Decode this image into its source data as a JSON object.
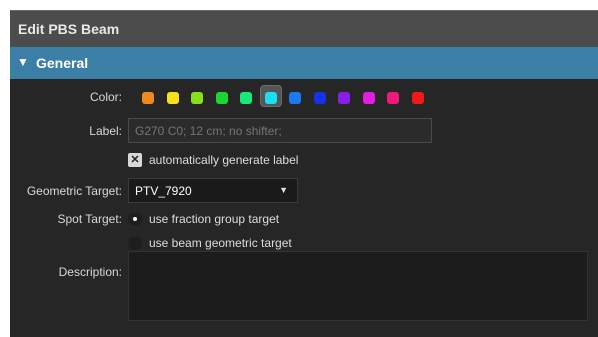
{
  "window": {
    "title": "Edit PBS Beam"
  },
  "section": {
    "title": "General"
  },
  "form": {
    "color_label": "Color:",
    "colors": [
      "#f08a1c",
      "#f5e019",
      "#86e01a",
      "#19d633",
      "#19e87a",
      "#19e0f0",
      "#1c7af0",
      "#1433e8",
      "#8a1ee8",
      "#e01ee0",
      "#f0197a",
      "#f01a1a"
    ],
    "selected_color_index": 5,
    "label_label": "Label:",
    "label_placeholder": "G270 C0; 12 cm; no shifter;",
    "auto_label_text": "automatically generate label",
    "auto_label_checked": true,
    "geo_target_label": "Geometric Target:",
    "geo_target_value": "PTV_7920",
    "spot_target_label": "Spot Target:",
    "spot_options": [
      "use fraction group target",
      "use beam geometric target"
    ],
    "spot_selected_index": 0,
    "description_label": "Description:"
  }
}
